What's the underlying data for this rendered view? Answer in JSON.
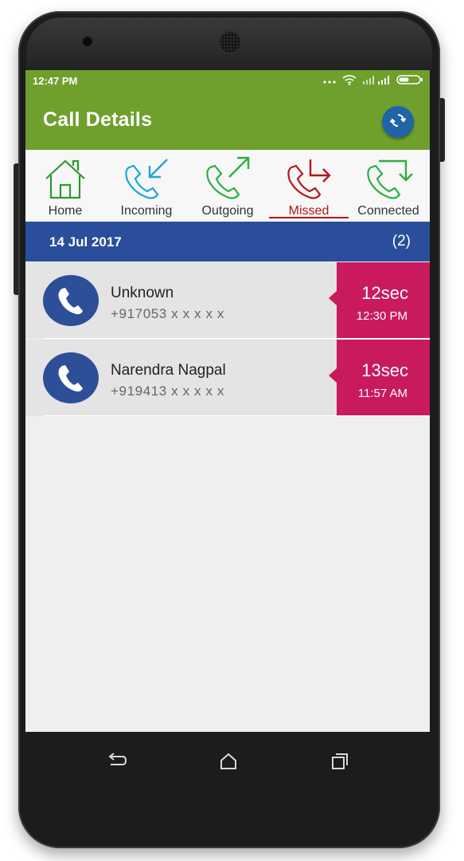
{
  "status_bar": {
    "time": "12:47 PM"
  },
  "app_bar": {
    "title": "Call Details"
  },
  "tabs": [
    {
      "label": "Home",
      "icon": "home-icon",
      "color": "#2e9a2e"
    },
    {
      "label": "Incoming",
      "icon": "incoming-call-icon",
      "color": "#1aa6d6"
    },
    {
      "label": "Outgoing",
      "icon": "outgoing-call-icon",
      "color": "#2cae43"
    },
    {
      "label": "Missed",
      "icon": "missed-call-icon",
      "color": "#b3161c",
      "selected": true
    },
    {
      "label": "Connected",
      "icon": "connected-call-icon",
      "color": "#2cae43"
    }
  ],
  "date_header": {
    "date": "14 Jul 2017",
    "count": "(2)"
  },
  "calls": [
    {
      "name": "Unknown",
      "number": "+917053 x x x x x",
      "duration": "12sec",
      "time": "12:30 PM"
    },
    {
      "name": "Narendra Nagpal",
      "number": "+919413 x x x x x",
      "duration": "13sec",
      "time": "11:57 AM"
    }
  ],
  "colors": {
    "app_bar": "#6f9f2c",
    "date_bar": "#2a4e9b",
    "badge": "#c91a5f",
    "refresh_button": "#1f64a7"
  }
}
